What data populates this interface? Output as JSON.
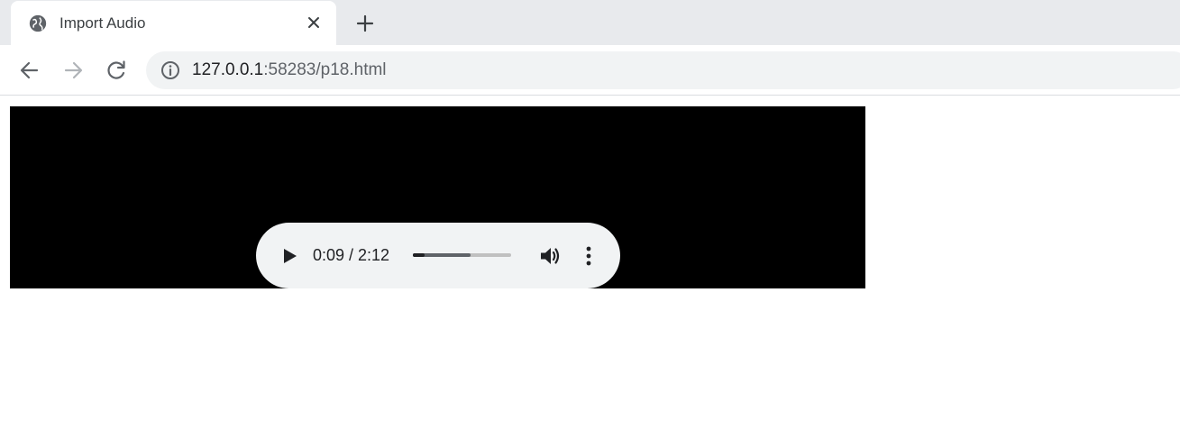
{
  "browser": {
    "tab": {
      "title": "Import Audio",
      "favicon": "globe-icon",
      "close": "close-icon"
    },
    "new_tab": "plus-icon",
    "nav": {
      "back": "arrow-left-icon",
      "forward": "arrow-right-icon",
      "reload": "reload-icon"
    },
    "address_bar": {
      "icon": "info-icon",
      "url_host": "127.0.0.1",
      "url_rest": ":58283/p18.html"
    }
  },
  "player": {
    "play_icon": "play-icon",
    "time": "0:09 / 2:12",
    "progress": {
      "played_fraction": 0.12,
      "buffered_fraction": 0.59
    },
    "volume_icon": "volume-icon",
    "more_icon": "more-vert-icon"
  },
  "colors": {
    "tabstrip": "#e8eaed",
    "player_bg": "#f1f3f4",
    "video_bg": "#000000"
  }
}
